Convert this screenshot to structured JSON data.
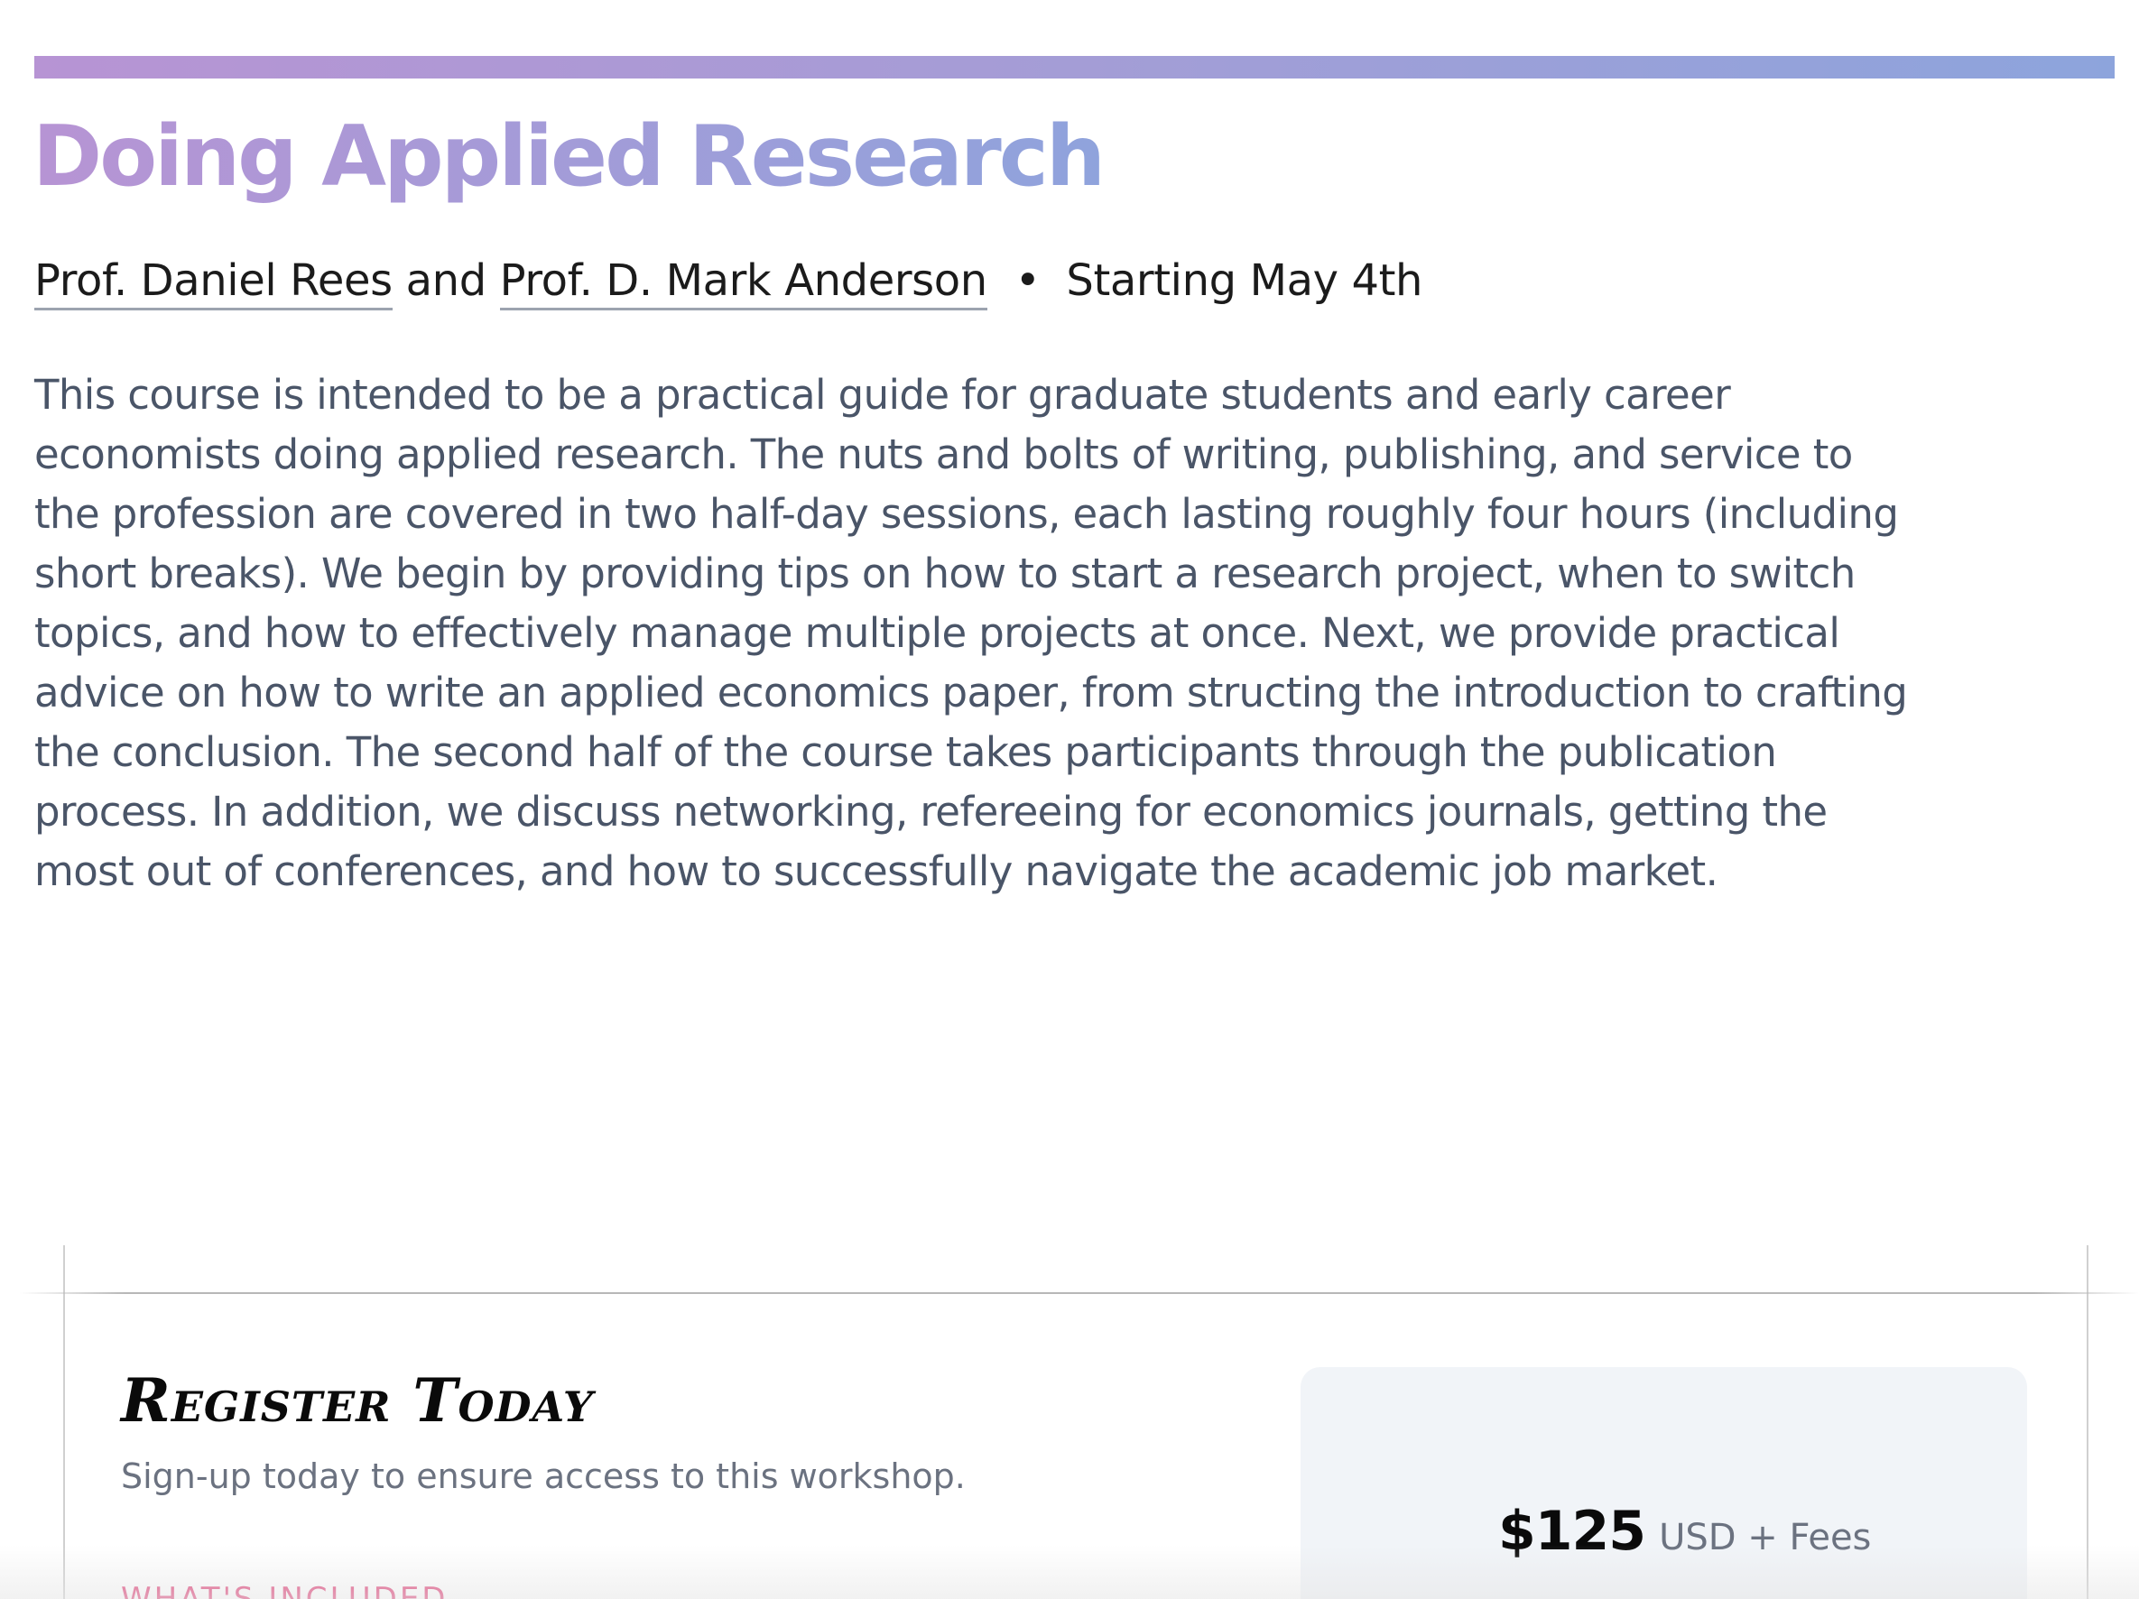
{
  "course": {
    "title": "Doing Applied Research",
    "authors": [
      {
        "name": "Prof. Daniel Rees"
      },
      {
        "name": "Prof. D. Mark Anderson"
      }
    ],
    "author_joiner": "and",
    "separator": "•",
    "start": "Starting May 4th",
    "description": "This course is intended to be a practical guide for graduate students and early career economists doing applied research. The nuts and bolts of writing, publishing, and service to the profession are covered in two half-day sessions, each lasting roughly four hours (including short breaks). We begin by providing tips on how to start a research project, when to switch topics, and how to effectively manage multiple projects at once. Next, we provide practical advice on how to write an applied economics paper, from structing the introduction to crafting the conclusion. The second half of the course takes participants through the publication process. In addition, we discuss networking, refereeing for economics journals, getting the most out of conferences, and how to successfully navigate the academic job market."
  },
  "register": {
    "title": "Register Today",
    "subtitle": "Sign-up today to ensure access to this workshop.",
    "included_label": "WHAT'S INCLUDED"
  },
  "pricing": {
    "amount": "$125",
    "currency_note": "USD + Fees"
  },
  "colors": {
    "gradient_start": "#b794d4",
    "gradient_end": "#8da4dc",
    "accent_pink": "#e0447a",
    "body_text": "#4a5568"
  }
}
